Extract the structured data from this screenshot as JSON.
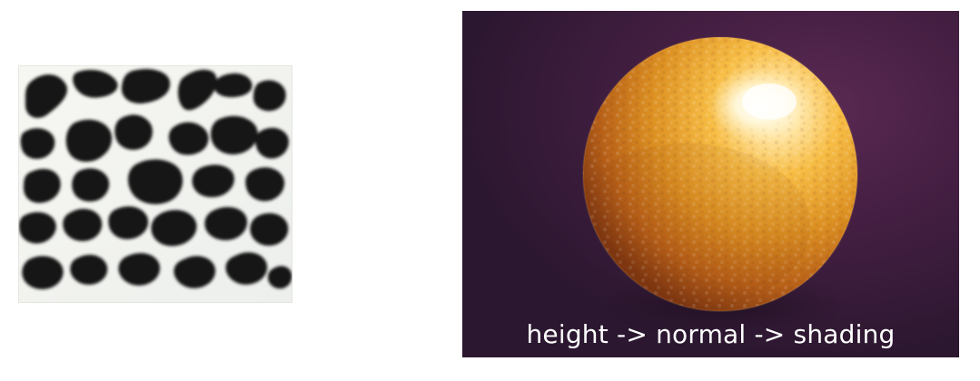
{
  "figures": {
    "texture": {
      "icon": "bump-height-texture"
    },
    "render": {
      "icon": "bump-mapped-orange",
      "caption": "height -> normal -> shading"
    }
  },
  "colors": {
    "background": "#ffffff",
    "texture_light": "#f3f3ef",
    "texture_dark": "#161616",
    "render_background": "#3c1b3a",
    "sphere_light": "#f5b338",
    "sphere_mid": "#d98d20",
    "sphere_shadow": "#8c3f12",
    "highlight": "#fffdf3",
    "caption": "#ffffff"
  }
}
